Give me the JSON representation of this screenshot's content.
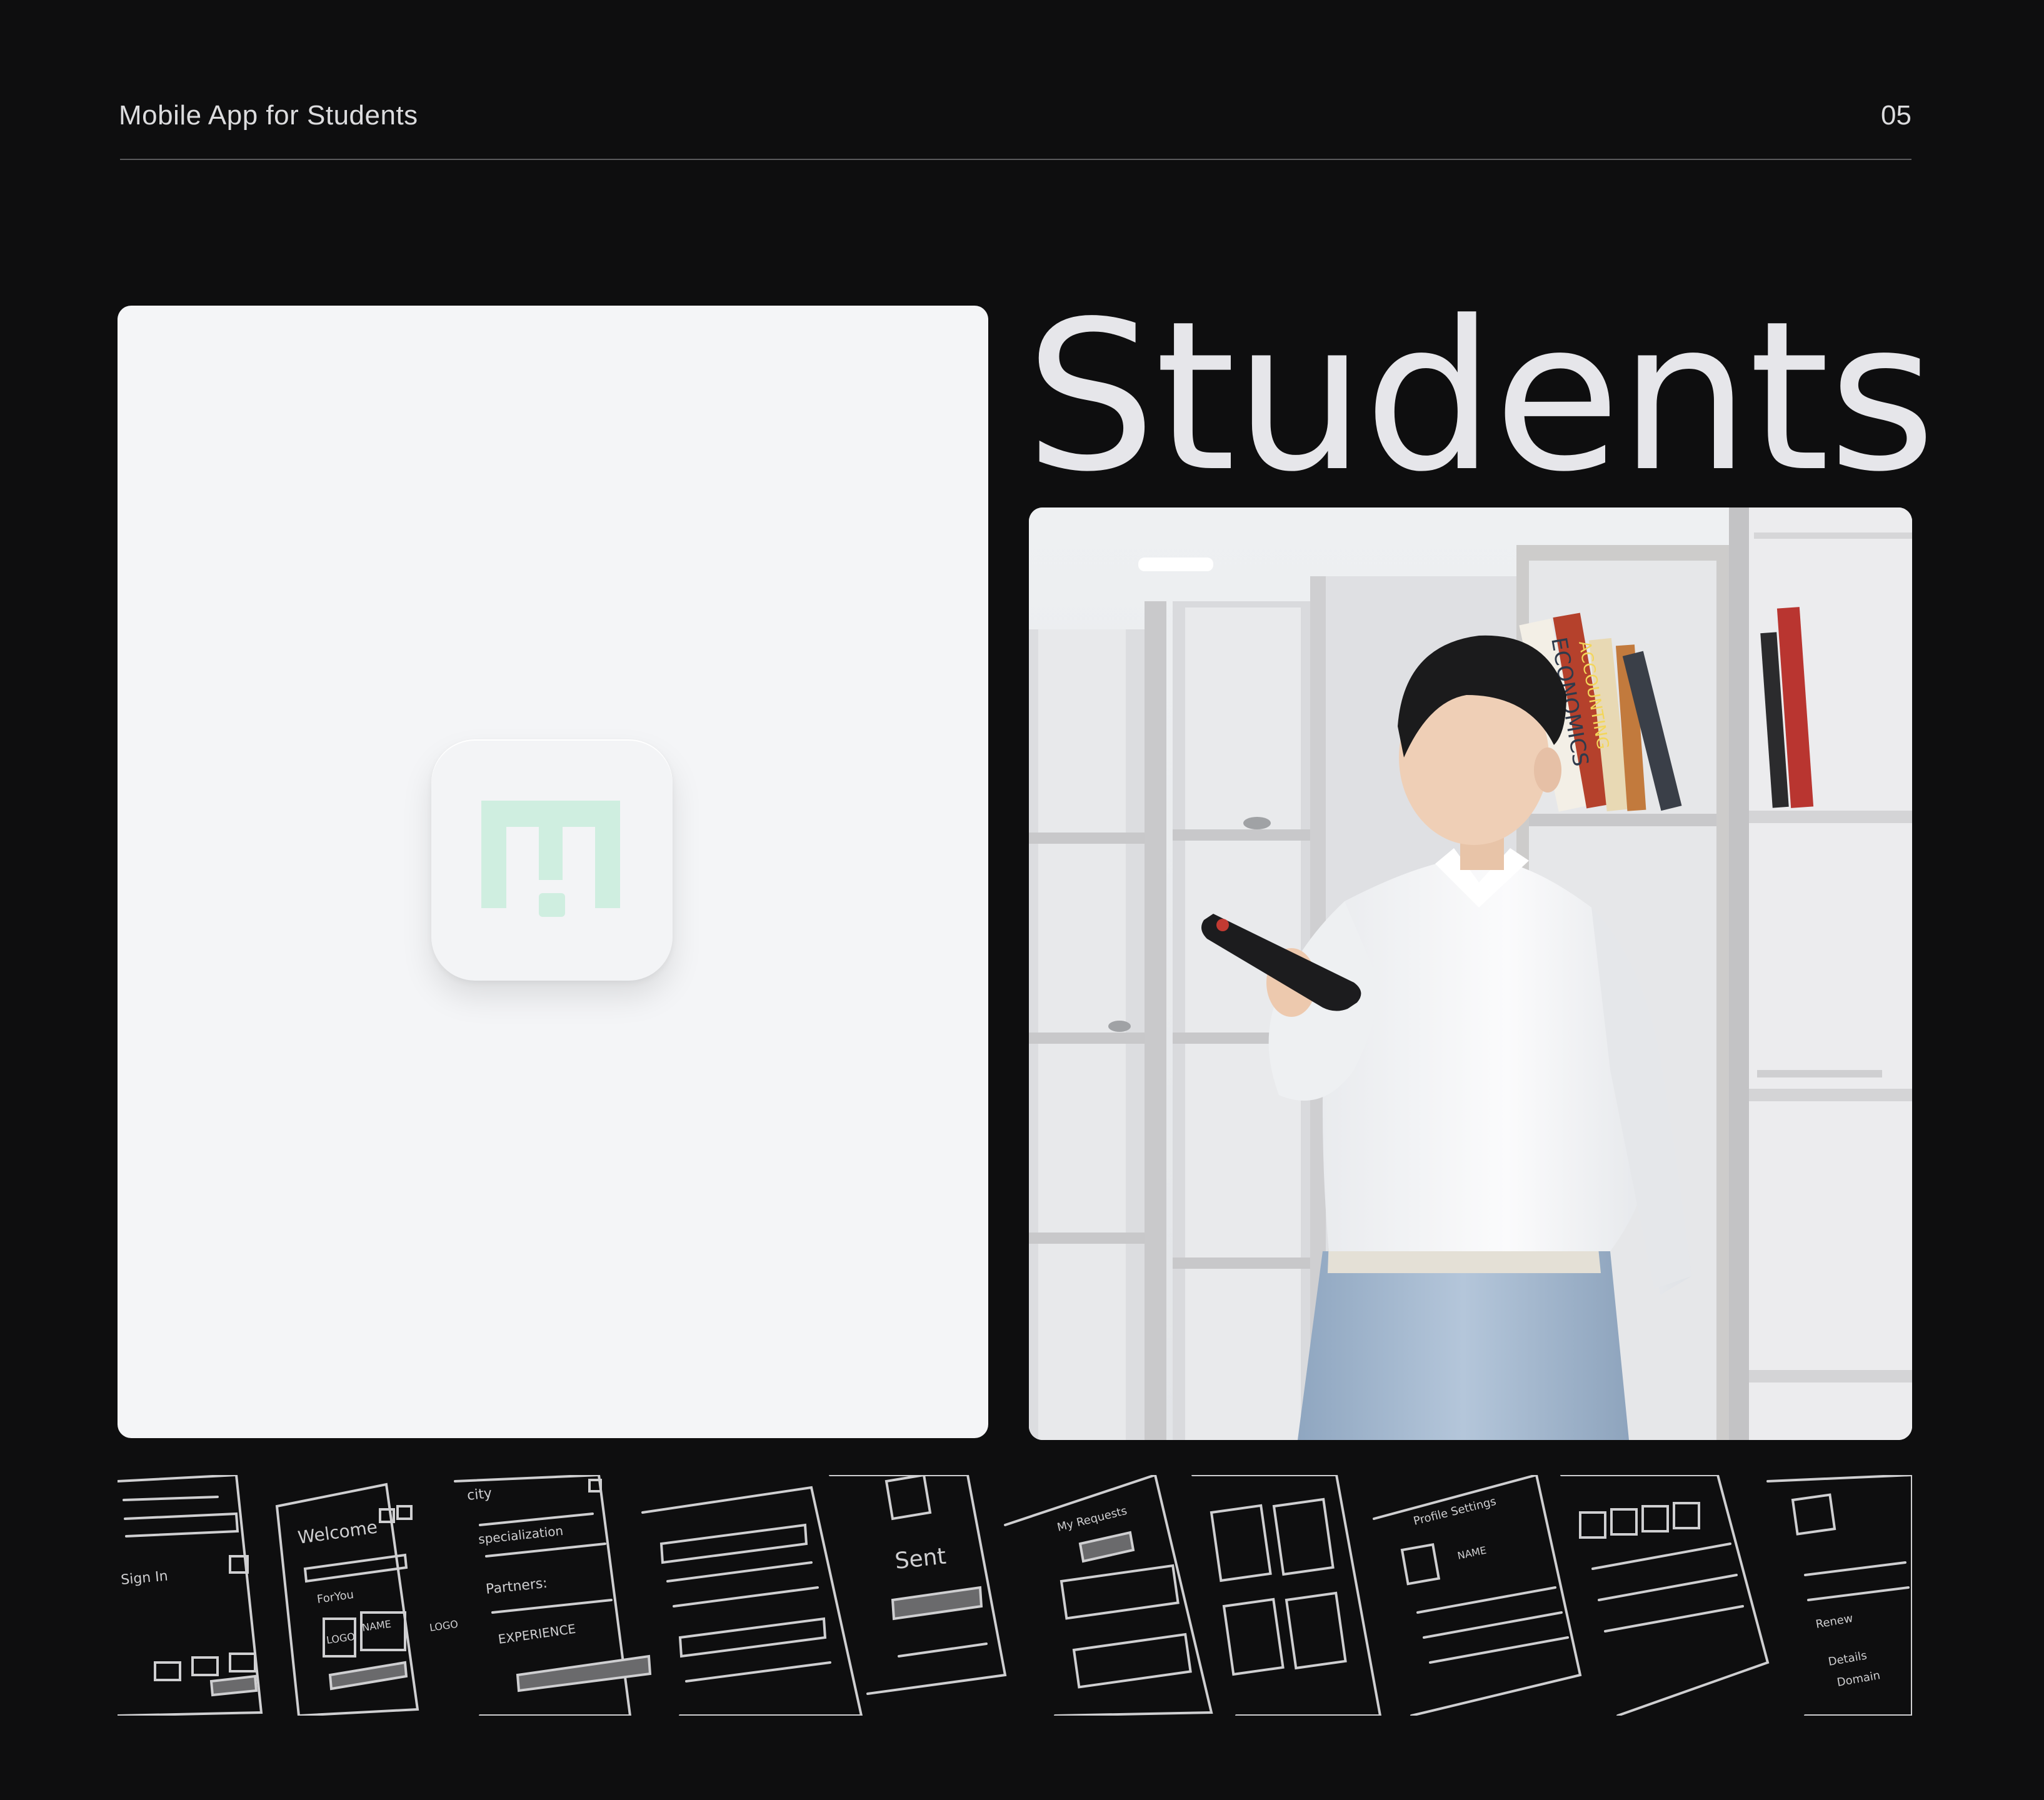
{
  "header": {
    "title": "Mobile App for Students",
    "page_number": "05"
  },
  "hero": {
    "title": "Students"
  },
  "logo_panel": {
    "icon": "app-logo-icon",
    "accent_color": "#cfeee0"
  },
  "photo": {
    "book_titles": [
      "ECONOMICS",
      "ACCOUNTING"
    ]
  },
  "sketches": {
    "labels": {
      "sign_in": "Sign In",
      "welcome": "Welcome",
      "for_you": "ForYou",
      "logo_1": "LOGO",
      "name_1": "NAME",
      "logo_2": "LOGO",
      "city": "city",
      "specialization": "specialization",
      "partners": "Partners:",
      "experience": "EXPERIENCE",
      "sent": "Sent",
      "my_requests": "My Requests",
      "profile_settings": "Profile Settings",
      "name_2": "NAME",
      "renew": "Renew",
      "details": "Details",
      "domain": "Domain"
    }
  }
}
